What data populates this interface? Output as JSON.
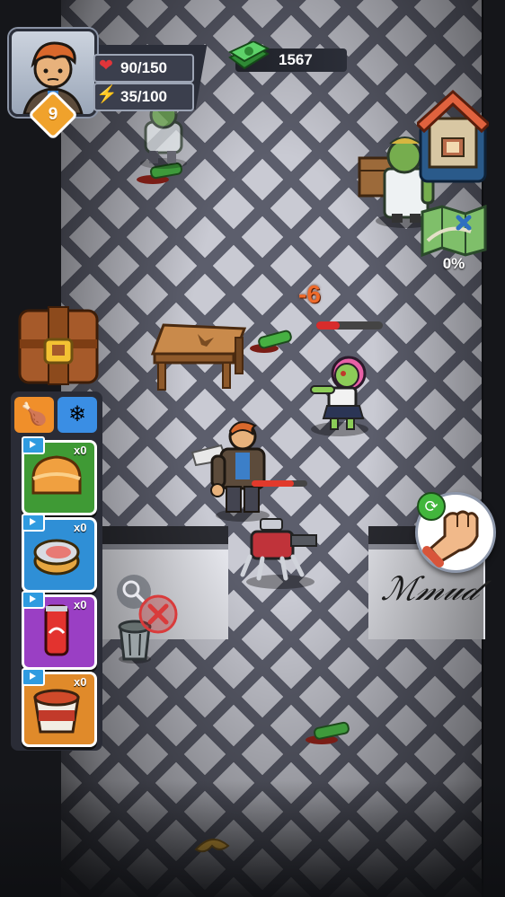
{
  "player": {
    "level": "9",
    "health": "90/150",
    "health_fill": 0.6,
    "energy": "35/100",
    "energy_fill": 0.35
  },
  "currency": {
    "cash": "1567",
    "icon": "cash-stack-icon"
  },
  "map": {
    "progress": "0%",
    "icon": "map-icon"
  },
  "home": {
    "icon": "house-icon"
  },
  "inventory": {
    "icon": "backpack-icon"
  },
  "item_tabs": [
    {
      "icon": "meat-icon"
    },
    {
      "icon": "ice-box-icon"
    }
  ],
  "items": [
    {
      "name": "bread",
      "count": "x0",
      "color": "#3f9a35"
    },
    {
      "name": "canned-food",
      "count": "x0",
      "color": "#2f8fd6"
    },
    {
      "name": "soda-can",
      "count": "x0",
      "color": "#9a3fc4"
    },
    {
      "name": "noodle-cup",
      "count": "x0",
      "color": "#e08a2a"
    }
  ],
  "combat": {
    "damage": "-6",
    "enemy_health_fill": 0.35,
    "player_health_fill": 0.75
  },
  "actions": {
    "attack_icon": "fist-icon",
    "swap_icon": "swap-icon"
  },
  "colors": {
    "health": "#e0353a",
    "energy": "#2d9ee8",
    "accent": "#f0a22c"
  }
}
